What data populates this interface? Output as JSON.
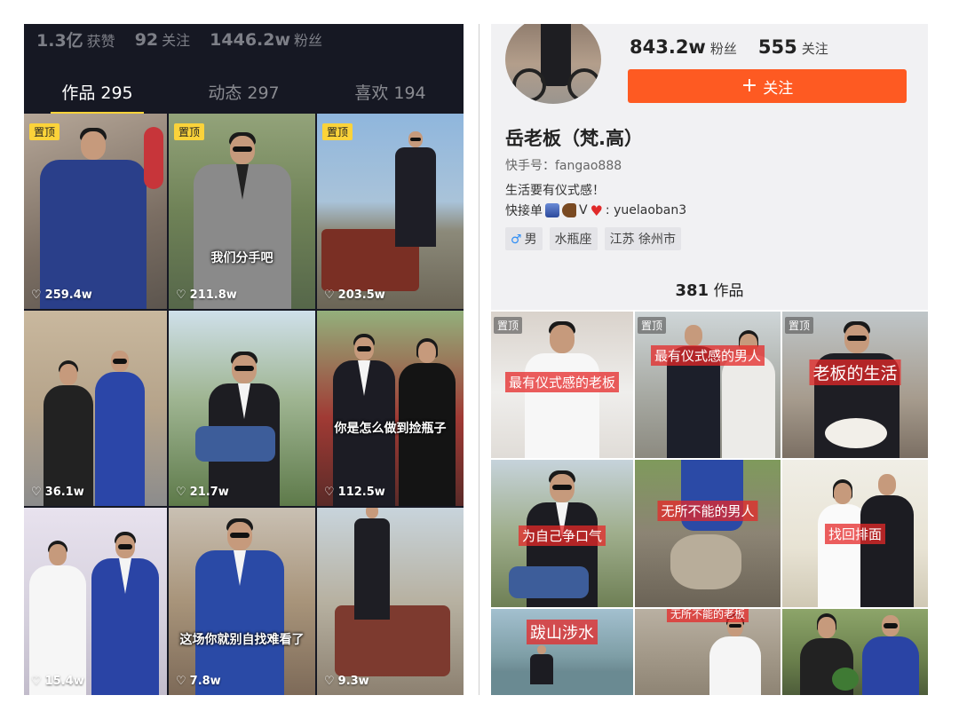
{
  "left_profile": {
    "stats": [
      {
        "value": "1.3亿",
        "label": "获赞"
      },
      {
        "value": "92",
        "label": "关注"
      },
      {
        "value": "1446.2w",
        "label": "粉丝"
      }
    ],
    "tabs": [
      {
        "label": "作品 295",
        "active": true
      },
      {
        "label": "动态 297",
        "active": false
      },
      {
        "label": "喜欢 194",
        "active": false
      }
    ],
    "pin_label": "置顶",
    "videos": [
      {
        "likes": "259.4w",
        "pinned": true,
        "caption": ""
      },
      {
        "likes": "211.8w",
        "pinned": true,
        "caption": "我们分手吧"
      },
      {
        "likes": "203.5w",
        "pinned": true,
        "caption": ""
      },
      {
        "likes": "36.1w",
        "pinned": false,
        "caption": ""
      },
      {
        "likes": "21.7w",
        "pinned": false,
        "caption": ""
      },
      {
        "likes": "112.5w",
        "pinned": false,
        "caption": "你是怎么做到捡瓶子"
      },
      {
        "likes": "15.4w",
        "pinned": false,
        "caption": ""
      },
      {
        "likes": "7.8w",
        "pinned": false,
        "caption": "这场你就别自找难看了"
      },
      {
        "likes": "9.3w",
        "pinned": false,
        "caption": ""
      }
    ]
  },
  "right_profile": {
    "fans_value": "843.2w",
    "fans_label": "粉丝",
    "follow_value": "555",
    "follow_label": "关注",
    "follow_button": "关注",
    "follow_button_plus": "+",
    "name": "岳老板（梵.高）",
    "kuaishou_id": "快手号：fangao888",
    "bio_line1": "生活要有仪式感！",
    "bio_line2_prefix": "快接单",
    "bio_line2_v": "V",
    "bio_line2_suffix": ": yuelaoban3",
    "tags": [
      {
        "label": "男",
        "icon": "male-symbol"
      },
      {
        "label": "水瓶座"
      },
      {
        "label": "江苏 徐州市"
      }
    ],
    "works_count": "381",
    "works_label": "作品",
    "pin_label": "置顶",
    "videos": [
      {
        "pinned": true,
        "caption": "最有仪式感的老板"
      },
      {
        "pinned": true,
        "caption": "最有仪式感的男人"
      },
      {
        "pinned": true,
        "caption": "老板的生活"
      },
      {
        "pinned": false,
        "caption": "为自己争口气"
      },
      {
        "pinned": false,
        "caption": "无所不能的男人"
      },
      {
        "pinned": false,
        "caption": "找回排面"
      },
      {
        "pinned": false,
        "caption": "跋山涉水"
      },
      {
        "pinned": false,
        "caption": "无所不能的老板"
      },
      {
        "pinned": false,
        "caption": ""
      }
    ]
  },
  "colors": {
    "left_bg": "#161823",
    "tab_indicator": "#fbd33a",
    "follow_button": "#fe5a22",
    "right_header_bg": "#f1f1f3",
    "caption_red": "#e62828"
  }
}
